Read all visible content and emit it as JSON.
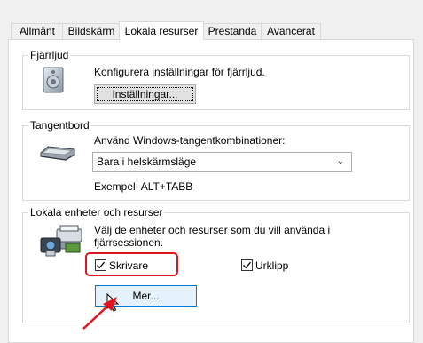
{
  "tabs": [
    "Allmänt",
    "Bildskärm",
    "Lokala resurser",
    "Prestanda",
    "Avancerat"
  ],
  "active_tab": "Lokala resurser",
  "remote_audio": {
    "title": "Fjärrljud",
    "description": "Konfigurera inställningar för fjärrljud.",
    "button": "Inställningar..."
  },
  "keyboard": {
    "title": "Tangentbord",
    "description": "Använd Windows-tangentkombinationer:",
    "selected": "Bara i helskärmsläge",
    "example": "Exempel: ALT+TABB"
  },
  "local_devices": {
    "title": "Lokala enheter och resurser",
    "description_line1": "Välj de enheter och resurser som du vill använda i",
    "description_line2": "fjärrsessionen.",
    "printers_label": "Skrivare",
    "printers_checked": true,
    "clipboard_label": "Urklipp",
    "clipboard_checked": true,
    "more_button": "Mer..."
  },
  "colors": {
    "highlight": "#e0141e",
    "focus": "#0078d7"
  }
}
